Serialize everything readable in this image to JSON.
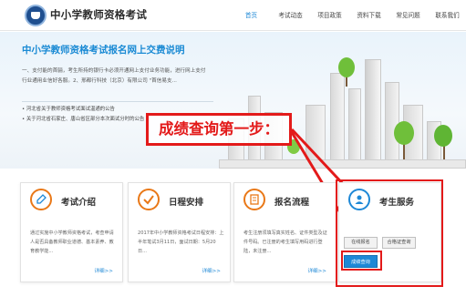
{
  "header": {
    "site_title": "中小学教师资格考试",
    "nav": [
      "首页",
      "考试动态",
      "项目政策",
      "资料下载",
      "常见问题",
      "联系我们"
    ],
    "active_index": 0,
    "accent_color": "#1e88d6"
  },
  "banner": {
    "title": "中小学教师资格考试报名网上交费说明",
    "text_line1": "一、支付能的首骊，考生所持的银行卡必须开通网上支付业务功能，进行网上支付",
    "text_line2": "行业通用业信好各服。2、邢都行科技（北京）有限公司 \"首信易支...",
    "notice1": "• 河北省关于教师资格考试面试温通的公告",
    "notice2": "• 关于河北省石家庄、唐山省区部分本次面试分时的公告"
  },
  "callout": {
    "text": "成绩查询第一步：",
    "color": "#e31a1a"
  },
  "cards": [
    {
      "title": "考试介绍",
      "icon": "pencil-icon",
      "body": "通过实施中小学教师资格考试，考查申请人是否具备教师职业道德、基本素养、教育教学能...",
      "more": "详细>>"
    },
    {
      "title": "日程安排",
      "icon": "checkmark-icon",
      "body": "2017年中小学教师资格考试日程安排：上半年笔试3月11日，面试日期：5月20日...",
      "more": "详细>>"
    },
    {
      "title": "报名流程",
      "icon": "document-icon",
      "body": "考生注册须填写真实姓名、证件类型及证件号码。已注册的考生填写用码进行登陆，未注册...",
      "more": "详细>>"
    },
    {
      "title": "考生服务",
      "icon": "user-icon",
      "buttons": [
        "在线报名",
        "合格证查询"
      ],
      "primary_button": "成绩查询"
    }
  ]
}
